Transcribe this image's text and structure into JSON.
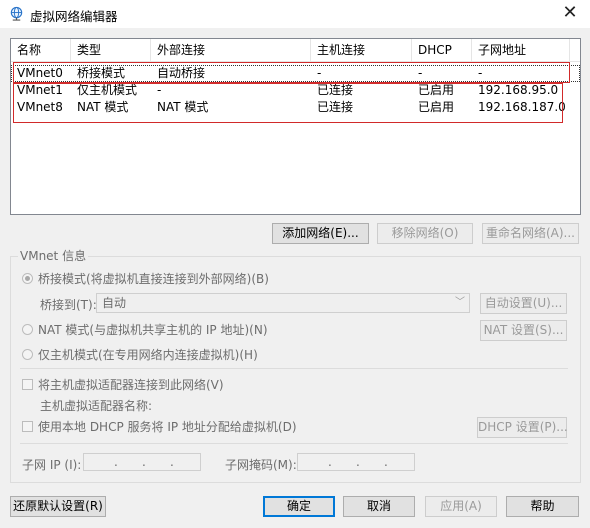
{
  "window": {
    "title": "虚拟网络编辑器",
    "close_glyph": "✕"
  },
  "table": {
    "columns": [
      "名称",
      "类型",
      "外部连接",
      "主机连接",
      "DHCP",
      "子网地址"
    ],
    "rows": [
      [
        "VMnet0",
        "桥接模式",
        "自动桥接",
        "-",
        "-",
        "-"
      ],
      [
        "VMnet1",
        "仅主机模式",
        "-",
        "已连接",
        "已启用",
        "192.168.95.0"
      ],
      [
        "VMnet8",
        "NAT 模式",
        "NAT 模式",
        "已连接",
        "已启用",
        "192.168.187.0"
      ]
    ]
  },
  "net_buttons": {
    "add": "添加网络(E)...",
    "remove": "移除网络(O)",
    "rename": "重命名网络(A)..."
  },
  "info": {
    "group_title": "VMnet 信息",
    "bridged_label": "桥接模式(将虚拟机直接连接到外部网络)(B)",
    "bridge_to_label": "桥接到(T):",
    "bridge_to_value": "自动",
    "auto_settings": "自动设置(U)...",
    "nat_label": "NAT 模式(与虚拟机共享主机的 IP 地址)(N)",
    "nat_settings": "NAT 设置(S)...",
    "hostonly_label": "仅主机模式(在专用网络内连接虚拟机)(H)",
    "connect_adapter_label": "将主机虚拟适配器连接到此网络(V)",
    "adapter_name_label": "主机虚拟适配器名称:",
    "dhcp_label": "使用本地 DHCP 服务将 IP 地址分配给虚拟机(D)",
    "dhcp_settings": "DHCP 设置(P)...",
    "subnet_ip_label": "子网 IP (I):",
    "subnet_mask_label": "子网掩码(M):",
    "ip_placeholder": " .  .  .",
    "mask_placeholder": " .  .  ."
  },
  "footer": {
    "restore": "还原默认设置(R)",
    "ok": "确定",
    "cancel": "取消",
    "apply": "应用(A)",
    "help": "帮助"
  },
  "colors": {
    "annotation_red": "#d12a2a",
    "accent": "#0078d7"
  }
}
